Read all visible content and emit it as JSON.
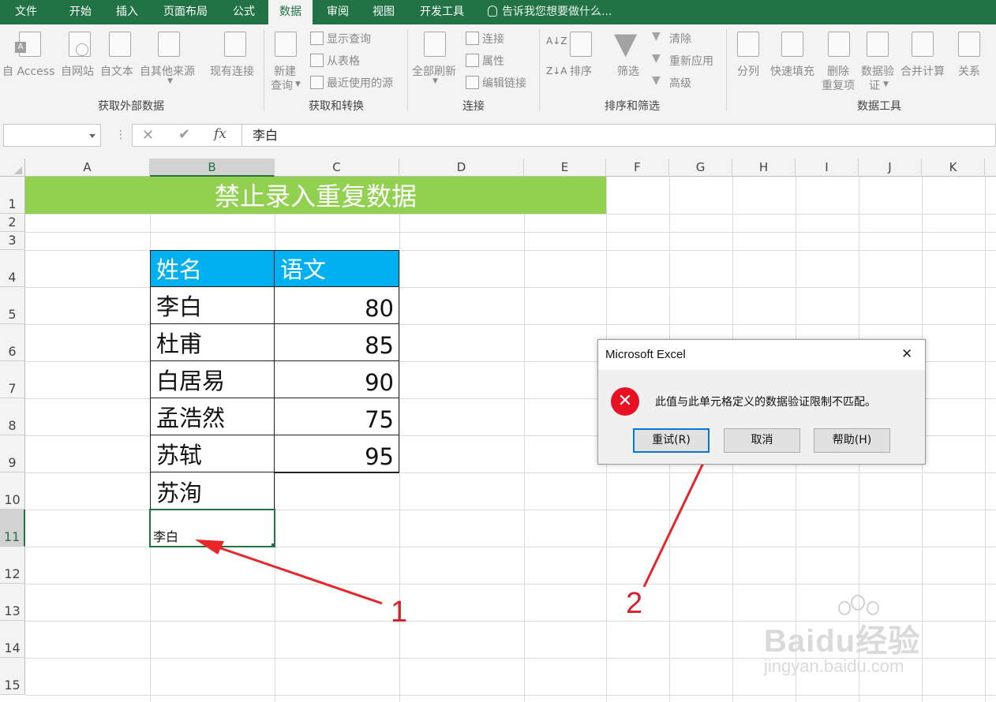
{
  "tabs": [
    "文件",
    "开始",
    "插入",
    "页面布局",
    "公式",
    "数据",
    "审阅",
    "视图",
    "开发工具"
  ],
  "active_tab": "数据",
  "tell_me": "告诉我您想要做什么...",
  "ribbon": {
    "ext_data": {
      "access": "自 Access",
      "web": "自网站",
      "text": "自文本",
      "other": "自其他来源",
      "existing": "现有连接",
      "group": "获取外部数据"
    },
    "transform": {
      "new_query": [
        "新建",
        "查询"
      ],
      "show_query": "显示查询",
      "from_table": "从表格",
      "recent": "最近使用的源",
      "group": "获取和转换"
    },
    "connections": {
      "refresh_all": "全部刷新",
      "connections": "连接",
      "properties": "属性",
      "edit_links": "编辑链接",
      "group": "连接"
    },
    "sort_filter": {
      "sort": "排序",
      "filter": "筛选",
      "clear": "清除",
      "reapply": "重新应用",
      "advanced": "高级",
      "group": "排序和筛选"
    },
    "data_tools": {
      "split": "分列",
      "flash_fill": "快速填充",
      "remove_dup": [
        "删除",
        "重复项"
      ],
      "validation": [
        "数据验",
        "证"
      ],
      "consolidate": "合并计算",
      "relations": "关系",
      "group": "数据工具"
    }
  },
  "formula_bar": {
    "name_box": "",
    "fx": "fx",
    "value": "李白"
  },
  "columns": [
    "A",
    "B",
    "C",
    "D",
    "E",
    "F",
    "G",
    "H",
    "I",
    "J",
    "K"
  ],
  "rows": [
    "1",
    "2",
    "3",
    "4",
    "5",
    "6",
    "7",
    "8",
    "9",
    "10",
    "11",
    "12",
    "13",
    "14",
    "15"
  ],
  "sheet": {
    "title": "禁止录入重复数据",
    "header": {
      "name": "姓名",
      "score": "语文"
    },
    "records": [
      {
        "name": "李白",
        "score": "80"
      },
      {
        "name": "杜甫",
        "score": "85"
      },
      {
        "name": "白居易",
        "score": "90"
      },
      {
        "name": "孟浩然",
        "score": "75"
      },
      {
        "name": "苏轼",
        "score": "95"
      },
      {
        "name": "苏洵",
        "score": ""
      }
    ],
    "editing_cell": "李白"
  },
  "dialog": {
    "title": "Microsoft Excel",
    "close": "✕",
    "message": "此值与此单元格定义的数据验证限制不匹配。",
    "buttons": {
      "retry": "重试(R)",
      "cancel": "取消",
      "help": "帮助(H)"
    }
  },
  "annotations": {
    "one": "1",
    "two": "2"
  },
  "watermark": {
    "main": "Baidu经验",
    "url": "jingyan.baidu.com"
  },
  "colors": {
    "excel_green": "#217346",
    "title_fill": "#92d050",
    "header_fill": "#00b0f0",
    "arrow": "#e8262a",
    "error": "#e81123"
  }
}
